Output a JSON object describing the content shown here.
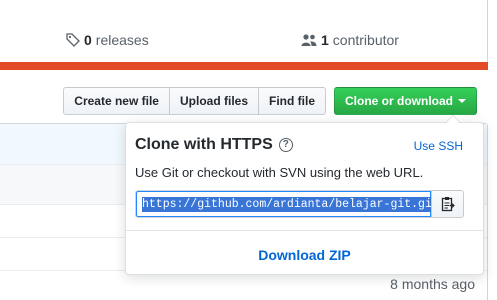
{
  "summary": {
    "releases": {
      "count": "0",
      "label": "releases",
      "icon": "tag-icon"
    },
    "contributors": {
      "count": "1",
      "label": "contributor",
      "icon": "people-icon"
    }
  },
  "language_bar": {
    "color": "#e34c26"
  },
  "file_nav": {
    "create_new_file": "Create new file",
    "upload_files": "Upload files",
    "find_file": "Find file",
    "clone_or_download": "Clone or download"
  },
  "clone_dropdown": {
    "title": "Clone with HTTPS",
    "help_icon": "question-icon",
    "use_ssh": "Use SSH",
    "description": "Use Git or checkout with SVN using the web URL.",
    "url": "https://github.com/ardianta/belajar-git.git",
    "copy_icon": "clipboard-icon",
    "download_zip": "Download ZIP"
  },
  "file_table": {
    "last_commit_age": "8 months ago"
  },
  "colors": {
    "accent_green": "#28a745",
    "link_blue": "#0366d6"
  }
}
